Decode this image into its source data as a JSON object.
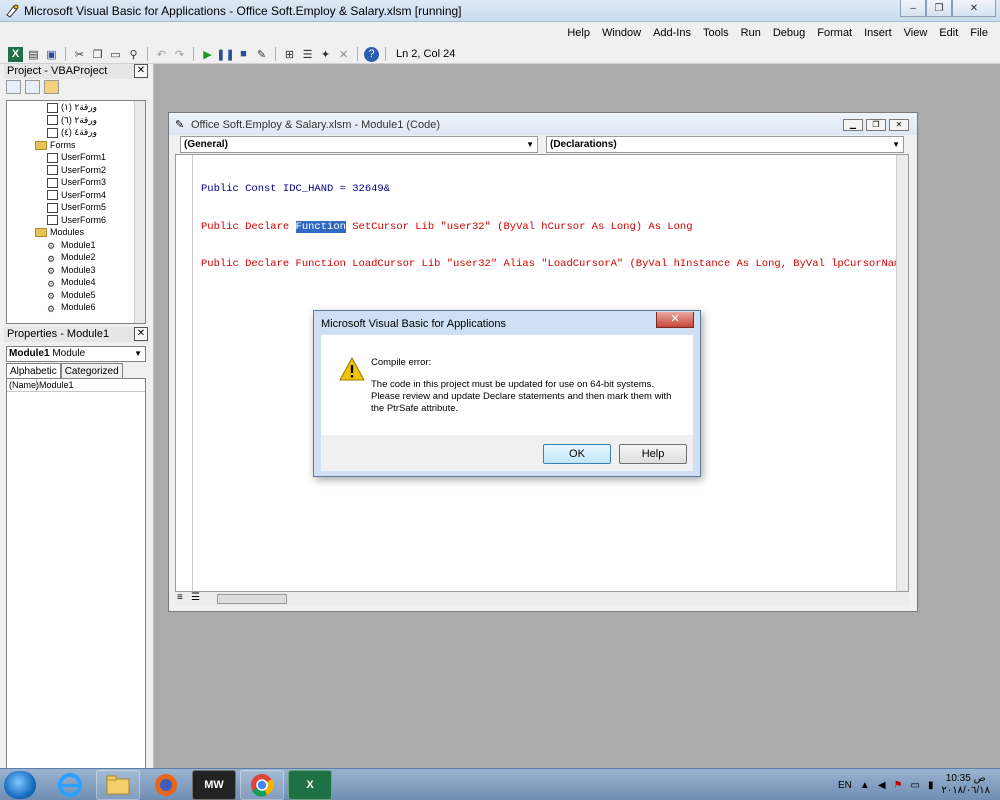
{
  "window": {
    "title": "Microsoft Visual Basic for Applications - Office Soft.Employ & Salary.xlsm [running]",
    "minimize": "–",
    "restore": "❐",
    "close": "✕"
  },
  "menu": [
    "File",
    "Edit",
    "View",
    "Insert",
    "Format",
    "Debug",
    "Run",
    "Tools",
    "Add-Ins",
    "Window",
    "Help"
  ],
  "toolbar": {
    "cursor_position": "Ln 2, Col 24"
  },
  "project_pane": {
    "title": "Project - VBAProject",
    "close": "✕",
    "tree": [
      {
        "label": "ورقة٢ (١)",
        "kind": "sheet",
        "indent": 3
      },
      {
        "label": "ورقة٢ (٦)",
        "kind": "sheet",
        "indent": 3
      },
      {
        "label": "ورقة٤ (٤)",
        "kind": "sheet",
        "indent": 3
      },
      {
        "label": "Forms",
        "kind": "folder",
        "indent": 2
      },
      {
        "label": "UserForm1",
        "kind": "form",
        "indent": 3
      },
      {
        "label": "UserForm2",
        "kind": "form",
        "indent": 3
      },
      {
        "label": "UserForm3",
        "kind": "form",
        "indent": 3
      },
      {
        "label": "UserForm4",
        "kind": "form",
        "indent": 3
      },
      {
        "label": "UserForm5",
        "kind": "form",
        "indent": 3
      },
      {
        "label": "UserForm6",
        "kind": "form",
        "indent": 3
      },
      {
        "label": "Modules",
        "kind": "folder",
        "indent": 2
      },
      {
        "label": "Module1",
        "kind": "module",
        "indent": 3
      },
      {
        "label": "Module2",
        "kind": "module",
        "indent": 3
      },
      {
        "label": "Module3",
        "kind": "module",
        "indent": 3
      },
      {
        "label": "Module4",
        "kind": "module",
        "indent": 3
      },
      {
        "label": "Module5",
        "kind": "module",
        "indent": 3
      },
      {
        "label": "Module6",
        "kind": "module",
        "indent": 3
      }
    ]
  },
  "properties_pane": {
    "title": "Properties - Module1",
    "close": "✕",
    "object_name": "Module1",
    "object_type": "Module",
    "tab_alphabetic": "Alphabetic",
    "tab_categorized": "Categorized",
    "rows": [
      {
        "key": "(Name)",
        "value": "Module1"
      }
    ]
  },
  "code_window": {
    "title": "Office Soft.Employ & Salary.xlsm - Module1 (Code)",
    "object_combo": "(General)",
    "proc_combo": "(Declarations)",
    "lines": [
      {
        "pre": "Public Const IDC_HAND = 32649&",
        "hl": "",
        "post": "",
        "color": "black"
      },
      {
        "pre": "Public Declare ",
        "hl": "Function",
        "post": " SetCursor Lib \"user32\" (ByVal hCursor As Long) As Long",
        "color": "red"
      },
      {
        "pre": "Public Declare Function LoadCursor Lib \"user32\" Alias \"LoadCursorA\" (ByVal hInstance As Long, ByVal lpCursorName",
        "hl": "",
        "post": "",
        "color": "red"
      }
    ]
  },
  "dialog": {
    "title": "Microsoft Visual Basic for Applications",
    "close": "✕",
    "heading": "Compile error:",
    "message_1": "The code in this project must be updated for use on 64-bit systems.",
    "message_2": "Please review and update Declare statements and then mark them with",
    "message_3": "the PtrSafe attribute.",
    "ok": "OK",
    "help": "Help"
  },
  "taskbar": {
    "lang": "EN",
    "time": "10:35 ص",
    "date": "٢٠١٨/٠٦/١٨",
    "excel": "X",
    "mw": "MW"
  }
}
